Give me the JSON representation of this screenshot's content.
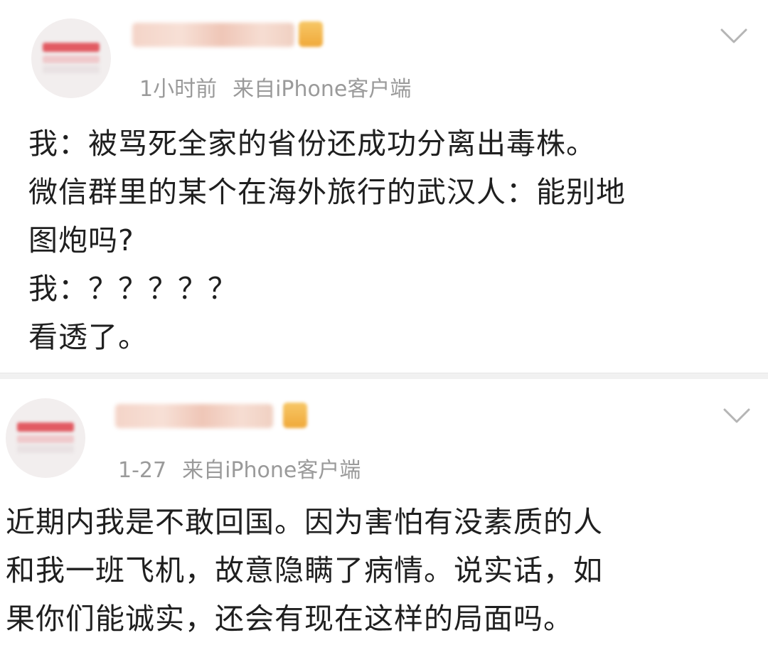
{
  "posts": [
    {
      "username": "",
      "time": "1小时前",
      "source": "来自iPhone客户端",
      "avatar_icon": "avatar-icon",
      "menu_icon": "chevron-down-icon",
      "lines": [
        "我：被骂死全家的省份还成功分离出毒株。",
        "微信群里的某个在海外旅行的武汉人：能别地",
        "图炮吗?",
        "我：？？？？？",
        "看透了。"
      ]
    },
    {
      "username": "",
      "time": "1-27",
      "source": "来自iPhone客户端",
      "avatar_icon": "avatar-icon",
      "menu_icon": "chevron-down-icon",
      "lines": [
        "近期内我是不敢回国。因为害怕有没素质的人",
        "和我一班飞机，故意隐瞒了病情。说实话，如",
        "果你们能诚实，还会有现在这样的局面吗。"
      ]
    }
  ],
  "colors": {
    "meta_text": "#9a9a9a",
    "body_text": "#1f1f1f",
    "divider": "#f1f1f1",
    "avatar_accent": "#e25b62",
    "vip_badge": "#f0a93a"
  }
}
